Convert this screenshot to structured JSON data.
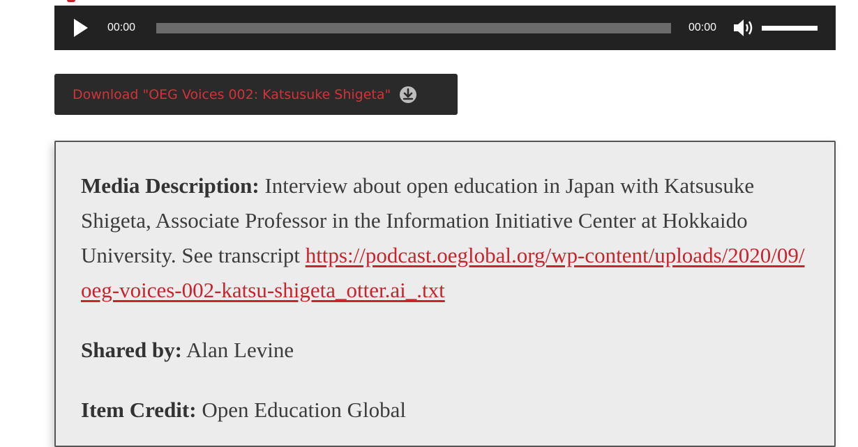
{
  "player": {
    "current_time": "00:00",
    "duration": "00:00",
    "progress": 0,
    "volume": 1.0,
    "play_icon": "play-icon",
    "mute_icon": "speaker-icon"
  },
  "download": {
    "label": "Download \"OEG Voices 002: Katsusuke Shigeta\"",
    "icon": "download-arrow-icon"
  },
  "media": {
    "description": {
      "label": "Media Description:",
      "text": " Interview about open education in Japan with Katsusuke Shigeta, Associate Professor in the Information Initiative Center at Hokkaido University. See transcript ",
      "link": "https://podcast.oeglobal.org/wp-content/uploads/2020/09/oeg-voices-002-katsu-shigeta_otter.ai_.txt"
    },
    "shared_by": {
      "label": "Shared by:",
      "value": " Alan Levine"
    },
    "item_credit": {
      "label": "Item Credit:",
      "value": " Open Education Global"
    }
  },
  "colors": {
    "accent": "#c8242d",
    "player_bg": "#222222",
    "box_bg": "#ececec"
  }
}
